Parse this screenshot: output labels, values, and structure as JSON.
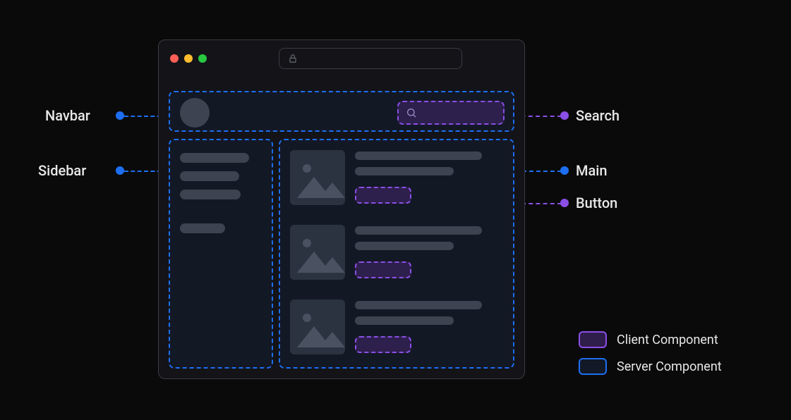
{
  "callouts": {
    "navbar": "Navbar",
    "sidebar": "Sidebar",
    "search": "Search",
    "main": "Main",
    "button": "Button"
  },
  "legend": {
    "client": "Client Component",
    "server": "Server Component"
  },
  "colors": {
    "server_border": "#1d6ff2",
    "client_border": "#8b4fe6",
    "window_bg": "#131318",
    "placeholder": "#3d4350"
  },
  "icons": {
    "lock": "lock-icon",
    "search": "search-icon",
    "image": "image-placeholder-icon"
  }
}
